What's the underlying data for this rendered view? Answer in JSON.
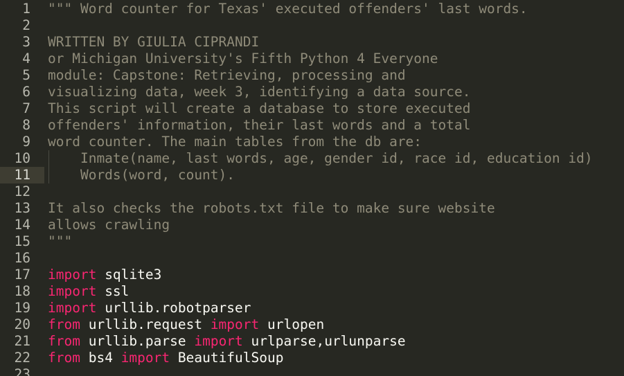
{
  "editor": {
    "theme": {
      "background": "#272822",
      "gutter_active": "#3e3d32",
      "docstring": "#8f8b79",
      "keyword": "#f92672",
      "text": "#f8f8f2"
    },
    "active_line": 11,
    "lines": [
      {
        "n": "1",
        "parts": [
          {
            "t": "\"\"\" Word counter for Texas' executed offenders' last words.",
            "c": "doc"
          }
        ]
      },
      {
        "n": "2",
        "parts": []
      },
      {
        "n": "3",
        "parts": [
          {
            "t": "WRITTEN BY GIULIA CIPRANDI",
            "c": "doc"
          }
        ]
      },
      {
        "n": "4",
        "parts": [
          {
            "t": "or Michigan University's Fifth Python 4 Everyone",
            "c": "doc"
          }
        ]
      },
      {
        "n": "5",
        "parts": [
          {
            "t": "module: Capstone: Retrieving, processing and",
            "c": "doc"
          }
        ]
      },
      {
        "n": "6",
        "parts": [
          {
            "t": "visualizing data, week 3, identifying a data source.",
            "c": "doc"
          }
        ]
      },
      {
        "n": "7",
        "parts": [
          {
            "t": "This script will create a database to store executed",
            "c": "doc"
          }
        ]
      },
      {
        "n": "8",
        "parts": [
          {
            "t": "offenders' information, their last words and a total",
            "c": "doc"
          }
        ]
      },
      {
        "n": "9",
        "parts": [
          {
            "t": "word counter. The main tables from the db are:",
            "c": "doc"
          }
        ]
      },
      {
        "n": "10",
        "parts": [
          {
            "t": "    Inmate(name, last words, age, gender id, race id, education id)",
            "c": "doc"
          }
        ]
      },
      {
        "n": "11",
        "parts": [
          {
            "t": "    Words(word, count).",
            "c": "doc"
          }
        ]
      },
      {
        "n": "12",
        "parts": []
      },
      {
        "n": "13",
        "parts": [
          {
            "t": "It also checks the robots.txt file to make sure website",
            "c": "doc"
          }
        ]
      },
      {
        "n": "14",
        "parts": [
          {
            "t": "allows crawling",
            "c": "doc"
          }
        ]
      },
      {
        "n": "15",
        "parts": [
          {
            "t": "\"\"\"",
            "c": "doc"
          }
        ]
      },
      {
        "n": "16",
        "parts": []
      },
      {
        "n": "17",
        "parts": [
          {
            "t": "import",
            "c": "kw"
          },
          {
            "t": " sqlite3",
            "c": "id"
          }
        ]
      },
      {
        "n": "18",
        "parts": [
          {
            "t": "import",
            "c": "kw"
          },
          {
            "t": " ssl",
            "c": "id"
          }
        ]
      },
      {
        "n": "19",
        "parts": [
          {
            "t": "import",
            "c": "kw"
          },
          {
            "t": " urllib.robotparser",
            "c": "id"
          }
        ]
      },
      {
        "n": "20",
        "parts": [
          {
            "t": "from",
            "c": "kw"
          },
          {
            "t": " urllib.request ",
            "c": "id"
          },
          {
            "t": "import",
            "c": "kw"
          },
          {
            "t": " urlopen",
            "c": "id"
          }
        ]
      },
      {
        "n": "21",
        "parts": [
          {
            "t": "from",
            "c": "kw"
          },
          {
            "t": " urllib.parse ",
            "c": "id"
          },
          {
            "t": "import",
            "c": "kw"
          },
          {
            "t": " urlparse,urlunparse",
            "c": "id"
          }
        ]
      },
      {
        "n": "22",
        "parts": [
          {
            "t": "from",
            "c": "kw"
          },
          {
            "t": " bs4 ",
            "c": "id"
          },
          {
            "t": "import",
            "c": "kw"
          },
          {
            "t": " BeautifulSoup",
            "c": "id"
          }
        ]
      },
      {
        "n": "23",
        "parts": []
      }
    ]
  }
}
